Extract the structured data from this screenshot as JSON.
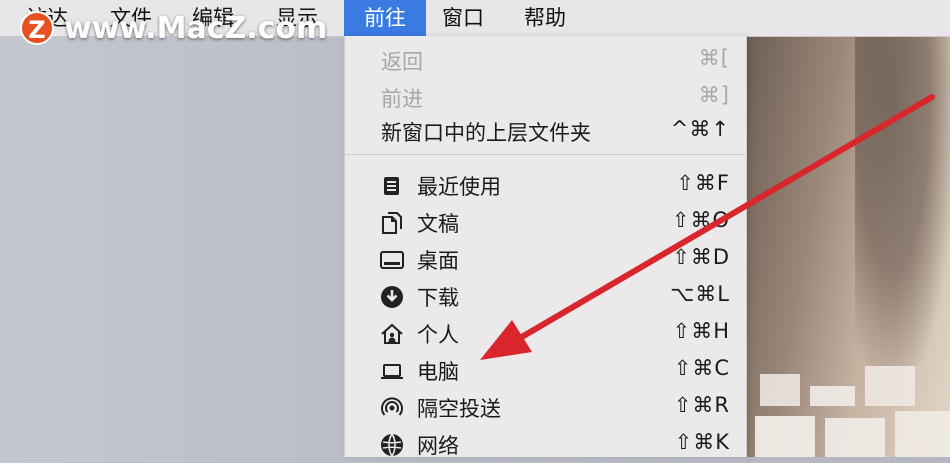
{
  "watermark": {
    "logo_letter": "Z",
    "text": "www.MacZ.com"
  },
  "menubar": {
    "items": [
      "访达",
      "文件",
      "编辑",
      "显示",
      "前往",
      "窗口",
      "帮助"
    ],
    "active_index": 4
  },
  "go_menu": {
    "items": [
      {
        "label": "返回",
        "shortcut": "⌘[",
        "disabled": true
      },
      {
        "label": "前进",
        "shortcut": "⌘]",
        "disabled": true
      },
      {
        "label": "新窗口中的上层文件夹",
        "shortcut": "^⌘↑",
        "disabled": false
      },
      {
        "label": "最近使用",
        "shortcut": "⇧⌘F",
        "icon": "recents-icon"
      },
      {
        "label": "文稿",
        "shortcut": "⇧⌘O",
        "icon": "documents-icon"
      },
      {
        "label": "桌面",
        "shortcut": "⇧⌘D",
        "icon": "desktop-icon"
      },
      {
        "label": "下载",
        "shortcut": "⌥⌘L",
        "icon": "downloads-icon"
      },
      {
        "label": "个人",
        "shortcut": "⇧⌘H",
        "icon": "home-icon"
      },
      {
        "label": "电脑",
        "shortcut": "⇧⌘C",
        "icon": "computer-icon"
      },
      {
        "label": "隔空投送",
        "shortcut": "⇧⌘R",
        "icon": "airdrop-icon"
      },
      {
        "label": "网络",
        "shortcut": "⇧⌘K",
        "icon": "network-icon"
      }
    ]
  },
  "colors": {
    "menubar_active": "#3a7be2",
    "arrow": "#d8262c",
    "watermark_logo": "#e65023"
  }
}
